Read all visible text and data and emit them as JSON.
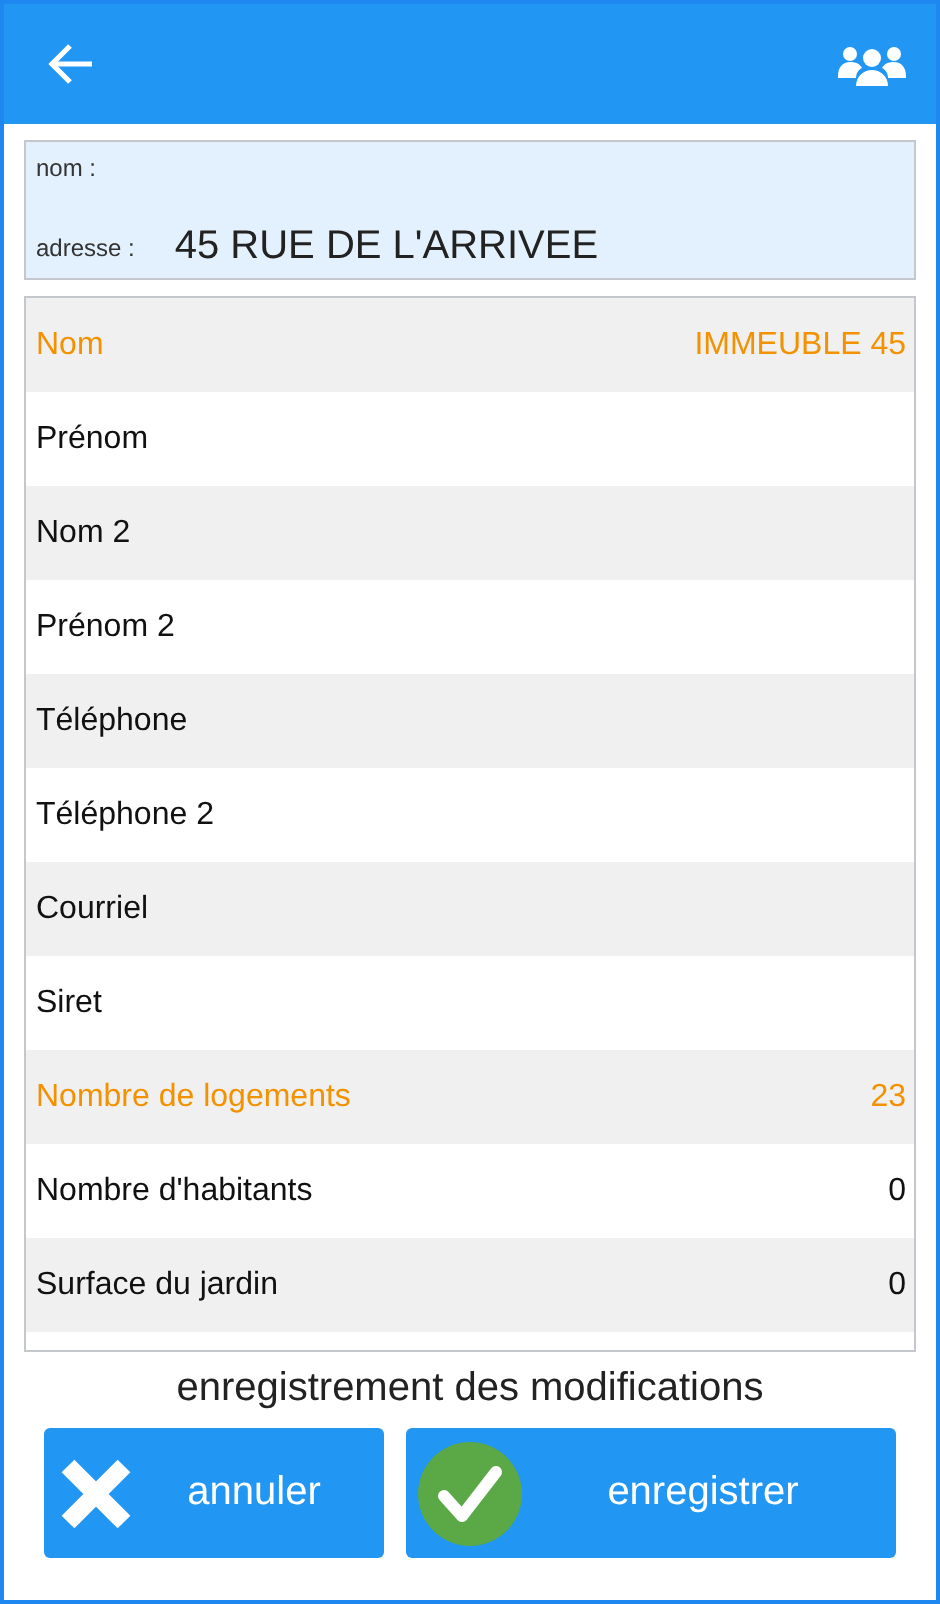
{
  "address_card": {
    "name_label": "nom :",
    "address_label": "adresse :",
    "address": "45 RUE DE L'ARRIVEE"
  },
  "fields": [
    {
      "label": "Nom",
      "value": "IMMEUBLE 45",
      "highlighted": true
    },
    {
      "label": "Prénom",
      "highlighted": false
    },
    {
      "label": "Nom 2",
      "highlighted": false
    },
    {
      "label": "Prénom 2",
      "highlighted": false
    },
    {
      "label": "Téléphone",
      "highlighted": false
    },
    {
      "label": "Téléphone 2",
      "highlighted": false
    },
    {
      "label": "Courriel",
      "highlighted": false
    },
    {
      "label": "Siret",
      "highlighted": false
    },
    {
      "label": "Nombre de logements",
      "value": "23",
      "highlighted": true
    },
    {
      "label": "Nombre d'habitants",
      "value": "0",
      "highlighted": false
    },
    {
      "label": "Surface du jardin",
      "value": "0",
      "highlighted": false
    }
  ],
  "footer": {
    "title": "enregistrement des modifications",
    "cancel": "annuler",
    "save": "enregistrer"
  }
}
